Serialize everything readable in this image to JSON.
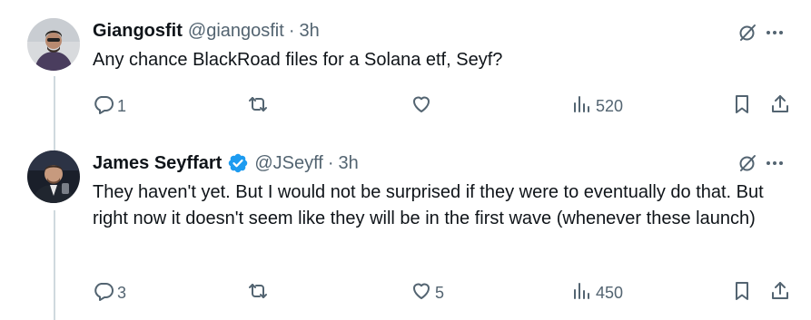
{
  "tweets": [
    {
      "name": "Giangosfit",
      "handle": "@giangosfit",
      "time": "3h",
      "text": "Any chance BlackRoad files for a Solana etf, Seyf?",
      "verified": false,
      "replies": "1",
      "reposts": "",
      "likes": "",
      "views": "520"
    },
    {
      "name": "James Seyffart",
      "handle": "@JSeyff",
      "time": "3h",
      "text": "They haven't yet. But I would not be surprised if they were to eventually do that. But right now it doesn't seem like they will be in the first wave (whenever these launch)",
      "verified": true,
      "replies": "3",
      "reposts": "",
      "likes": "5",
      "views": "450"
    }
  ],
  "separator": "·",
  "colors": {
    "text": "#0f1419",
    "muted": "#536471",
    "verified": "#1d9bf0",
    "thread_line": "#cfd9de"
  },
  "icons": [
    "grok-icon",
    "more-icon",
    "reply-icon",
    "repost-icon",
    "like-icon",
    "views-icon",
    "bookmark-icon",
    "share-icon",
    "verified-badge-icon"
  ]
}
